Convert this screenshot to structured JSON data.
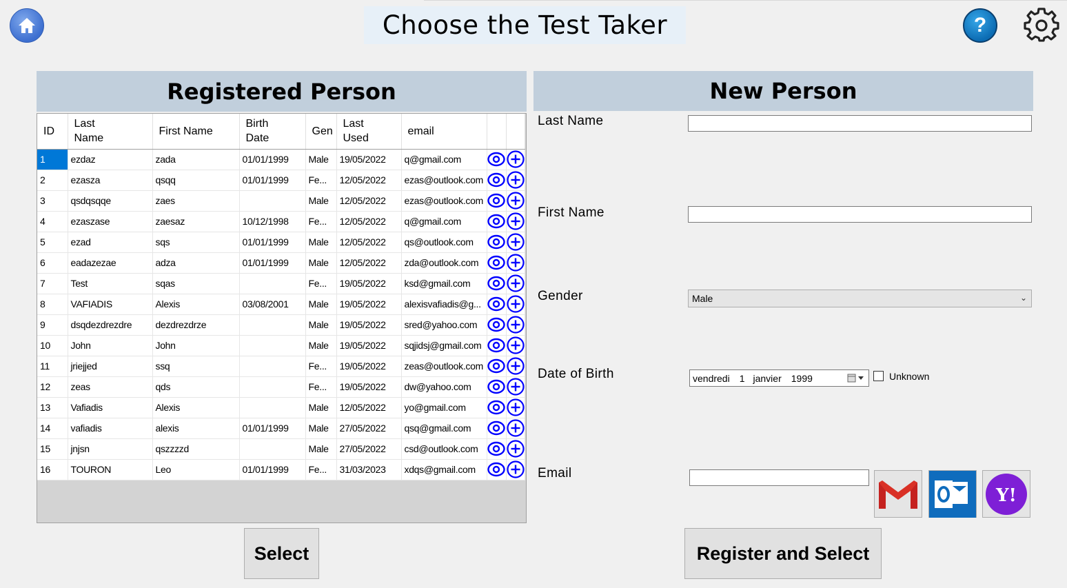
{
  "header": {
    "title": "Choose the Test Taker",
    "home_icon": "home-icon",
    "help_label": "?",
    "settings_icon": "gear-icon"
  },
  "registered": {
    "title": "Registered Person",
    "columns": [
      "ID",
      "Last\nName",
      "First Name",
      "Birth\nDate",
      "Gen",
      "Last\nUsed",
      "email"
    ],
    "rows": [
      {
        "id": "1",
        "last": "ezdaz",
        "first": "zada",
        "birth": "01/01/1999",
        "gen": "Male",
        "used": "19/05/2022",
        "email": "q@gmail.com"
      },
      {
        "id": "2",
        "last": "ezasza",
        "first": "qsqq",
        "birth": "01/01/1999",
        "gen": "Fe...",
        "used": "12/05/2022",
        "email": "ezas@outlook.com"
      },
      {
        "id": "3",
        "last": "qsdqsqqe",
        "first": "zaes",
        "birth": "",
        "gen": "Male",
        "used": "12/05/2022",
        "email": "ezas@outlook.com"
      },
      {
        "id": "4",
        "last": "ezaszase",
        "first": "zaesaz",
        "birth": "10/12/1998",
        "gen": "Fe...",
        "used": "12/05/2022",
        "email": "q@gmail.com"
      },
      {
        "id": "5",
        "last": "ezad",
        "first": "sqs",
        "birth": "01/01/1999",
        "gen": "Male",
        "used": "12/05/2022",
        "email": "qs@outlook.com"
      },
      {
        "id": "6",
        "last": "eadazezae",
        "first": "adza",
        "birth": "01/01/1999",
        "gen": "Male",
        "used": "12/05/2022",
        "email": "zda@outlook.com"
      },
      {
        "id": "7",
        "last": "Test",
        "first": "sqas",
        "birth": "",
        "gen": "Fe...",
        "used": "19/05/2022",
        "email": "ksd@gmail.com"
      },
      {
        "id": "8",
        "last": "VAFIADIS",
        "first": "Alexis",
        "birth": "03/08/2001",
        "gen": "Male",
        "used": "19/05/2022",
        "email": "alexisvafiadis@g..."
      },
      {
        "id": "9",
        "last": "dsqdezdrezdre",
        "first": "dezdrezdrze",
        "birth": "",
        "gen": "Male",
        "used": "19/05/2022",
        "email": "sred@yahoo.com"
      },
      {
        "id": "10",
        "last": "John",
        "first": "John",
        "birth": "",
        "gen": "Male",
        "used": "19/05/2022",
        "email": "sqjidsj@gmail.com"
      },
      {
        "id": "11",
        "last": "jriejjed",
        "first": "ssq",
        "birth": "",
        "gen": "Fe...",
        "used": "19/05/2022",
        "email": "zeas@outlook.com"
      },
      {
        "id": "12",
        "last": "zeas",
        "first": "qds",
        "birth": "",
        "gen": "Fe...",
        "used": "19/05/2022",
        "email": "dw@yahoo.com"
      },
      {
        "id": "13",
        "last": "Vafiadis",
        "first": "Alexis",
        "birth": "",
        "gen": "Male",
        "used": "12/05/2022",
        "email": "yo@gmail.com"
      },
      {
        "id": "14",
        "last": "vafiadis",
        "first": "alexis",
        "birth": "01/01/1999",
        "gen": "Male",
        "used": "27/05/2022",
        "email": "qsq@gmail.com"
      },
      {
        "id": "15",
        "last": "jnjsn",
        "first": "qszzzzd",
        "birth": "",
        "gen": "Male",
        "used": "27/05/2022",
        "email": "csd@outlook.com"
      },
      {
        "id": "16",
        "last": "TOURON",
        "first": "Leo",
        "birth": "01/01/1999",
        "gen": "Fe...",
        "used": "31/03/2023",
        "email": "xdqs@gmail.com"
      }
    ],
    "selected_row": 1,
    "row_actions": [
      "eye-icon",
      "plus-circle-icon"
    ],
    "select_label": "Select"
  },
  "new_person": {
    "title": "New Person",
    "last_name_label": "Last Name",
    "last_name_value": "",
    "first_name_label": "First Name",
    "first_name_value": "",
    "gender_label": "Gender",
    "gender_value": "Male",
    "dob_label": "Date of Birth",
    "dob_day_name": "vendredi",
    "dob_day": "1",
    "dob_month": "janvier",
    "dob_year": "1999",
    "unknown_label": "Unknown",
    "unknown_checked": false,
    "email_label": "Email",
    "email_value": "",
    "email_providers": [
      "gmail-icon",
      "outlook-icon",
      "yahoo-icon"
    ],
    "register_label": "Register and Select"
  },
  "colors": {
    "section_header": "#c1cfdc",
    "title_bg": "#e7f0f8",
    "selection": "#0078d7",
    "action_icon": "#0000ff"
  }
}
